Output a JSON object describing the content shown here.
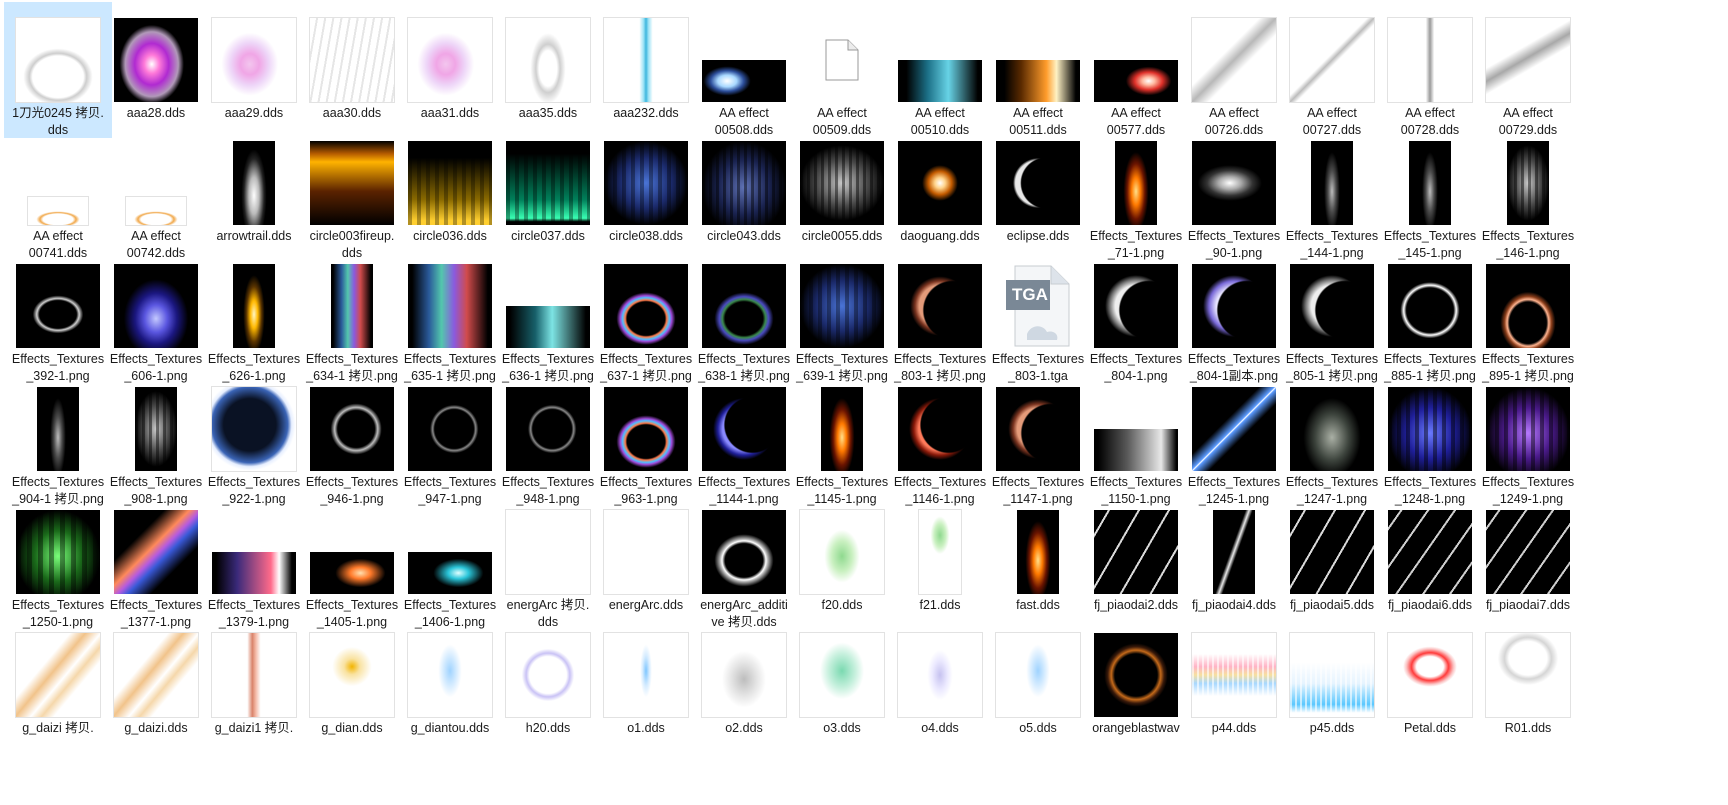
{
  "selected_index": 0,
  "files": [
    {
      "name": "1刀光0245 拷贝.\ndds",
      "style": "arc-white",
      "bg": "#ffffff"
    },
    {
      "name": "aaa28.dds",
      "style": "flame-pink",
      "bg": "#000000"
    },
    {
      "name": "aaa29.dds",
      "style": "flame-pink-soft",
      "bg": "#ffffff"
    },
    {
      "name": "aaa30.dds",
      "style": "rays-grey",
      "bg": "#ffffff"
    },
    {
      "name": "aaa31.dds",
      "style": "flame-pink-soft",
      "bg": "#ffffff"
    },
    {
      "name": "aaa35.dds",
      "style": "arch-grey",
      "bg": "#ffffff"
    },
    {
      "name": "aaa232.dds",
      "style": "spike-blue",
      "bg": "#ffffff"
    },
    {
      "name": "AA    effect\n00508.dds",
      "style": "comet-blue",
      "bg": "#000000",
      "shape": "wide"
    },
    {
      "name": "AA    effect\n00509.dds",
      "style": "doc-icon",
      "bg": "none"
    },
    {
      "name": "AA    effect\n00510.dds",
      "style": "streak-cyan",
      "bg": "#000000",
      "shape": "wide"
    },
    {
      "name": "AA    effect\n00511.dds",
      "style": "streak-orange",
      "bg": "#000000",
      "shape": "wide"
    },
    {
      "name": "AA    effect\n00577.dds",
      "style": "comet-red",
      "bg": "#000000",
      "shape": "wide"
    },
    {
      "name": "AA    effect\n00726.dds",
      "style": "slash-grey",
      "bg": "#ffffff"
    },
    {
      "name": "AA    effect\n00727.dds",
      "style": "slash-thin",
      "bg": "#ffffff"
    },
    {
      "name": "AA    effect\n00728.dds",
      "style": "vline-grey",
      "bg": "#ffffff"
    },
    {
      "name": "AA    effect\n00729.dds",
      "style": "wave-grey",
      "bg": "#ffffff"
    },
    {
      "name": "AA    effect\n00741.dds",
      "style": "swoosh-orange",
      "bg": "#ffffff",
      "shape": "small"
    },
    {
      "name": "AA    effect\n00742.dds",
      "style": "swoosh-orange",
      "bg": "#ffffff",
      "shape": "small"
    },
    {
      "name": "arrowtrail.dds",
      "style": "feather-white",
      "bg": "#000000",
      "shape": "tall"
    },
    {
      "name": "circle003fireup.\ndds",
      "style": "curtain-orange",
      "bg": "#000000"
    },
    {
      "name": "circle036.dds",
      "style": "curtain-gold",
      "bg": "#000000"
    },
    {
      "name": "circle037.dds",
      "style": "curtain-green",
      "bg": "#000000"
    },
    {
      "name": "circle038.dds",
      "style": "curtain-blue",
      "bg": "#000000"
    },
    {
      "name": "circle043.dds",
      "style": "curtain-navy",
      "bg": "#000000"
    },
    {
      "name": "circle0055.dds",
      "style": "curtain-grey",
      "bg": "#000000"
    },
    {
      "name": "daoguang.dds",
      "style": "burst-orange",
      "bg": "#000000"
    },
    {
      "name": "eclipse.dds",
      "style": "crescent-white",
      "bg": "#000000"
    },
    {
      "name": "Effects_Textures\n_71-1.png",
      "style": "flame-orange",
      "bg": "#000000",
      "shape": "tall"
    },
    {
      "name": "Effects_Textures\n_90-1.png",
      "style": "sparks-white",
      "bg": "#000000"
    },
    {
      "name": "Effects_Textures\n_144-1.png",
      "style": "feather-dim",
      "bg": "#000000",
      "shape": "tall"
    },
    {
      "name": "Effects_Textures\n_145-1.png",
      "style": "feather-dim",
      "bg": "#000000",
      "shape": "tall"
    },
    {
      "name": "Effects_Textures\n_146-1.png",
      "style": "curtain-grey",
      "bg": "#000000",
      "shape": "tall"
    },
    {
      "name": "Effects_Textures\n_392-1.png",
      "style": "arc-bottom",
      "bg": "#000000"
    },
    {
      "name": "Effects_Textures\n_606-1.png",
      "style": "flame-blue",
      "bg": "#000000"
    },
    {
      "name": "Effects_Textures\n_626-1.png",
      "style": "flame-gold",
      "bg": "#000000",
      "shape": "tall"
    },
    {
      "name": "Effects_Textures\n_634-1 拷贝.png",
      "style": "curtain-rainbow",
      "bg": "#000000",
      "shape": "tall"
    },
    {
      "name": "Effects_Textures\n_635-1 拷贝.png",
      "style": "curtain-rainbow",
      "bg": "#000000"
    },
    {
      "name": "Effects_Textures\n_636-1 拷贝.png",
      "style": "streak-teal",
      "bg": "#000000",
      "shape": "wide"
    },
    {
      "name": "Effects_Textures\n_637-1 拷贝.png",
      "style": "rings-rainbow",
      "bg": "#000000"
    },
    {
      "name": "Effects_Textures\n_638-1 拷贝.png",
      "style": "rings-dim",
      "bg": "#000000"
    },
    {
      "name": "Effects_Textures\n_639-1 拷贝.png",
      "style": "curtain-blue",
      "bg": "#000000"
    },
    {
      "name": "Effects_Textures\n_803-1 拷贝.png",
      "style": "crescent-copper",
      "bg": "#000000"
    },
    {
      "name": "Effects_Textures\n_803-1.tga",
      "style": "tga-icon",
      "bg": "none",
      "icon_text": "TGA"
    },
    {
      "name": "Effects_Textures\n_804-1.png",
      "style": "crescent-silver",
      "bg": "#000000"
    },
    {
      "name": "Effects_Textures\n_804-1副本.png",
      "style": "crescent-violet",
      "bg": "#000000"
    },
    {
      "name": "Effects_Textures\n_805-1 拷贝.png",
      "style": "crescent-silver",
      "bg": "#000000"
    },
    {
      "name": "Effects_Textures\n_885-1 拷贝.png",
      "style": "ring-white",
      "bg": "#000000"
    },
    {
      "name": "Effects_Textures\n_895-1 拷贝.png",
      "style": "arch-copper",
      "bg": "#000000"
    },
    {
      "name": "Effects_Textures\n_904-1 拷贝.png",
      "style": "feather-dim",
      "bg": "#000000",
      "shape": "tall"
    },
    {
      "name": "Effects_Textures\n_908-1.png",
      "style": "curtain-grey",
      "bg": "#000000",
      "shape": "tall"
    },
    {
      "name": "Effects_Textures\n_922-1.png",
      "style": "orb-blue",
      "bg": "#ffffff"
    },
    {
      "name": "Effects_Textures\n_946-1.png",
      "style": "swirl-grey",
      "bg": "#000000"
    },
    {
      "name": "Effects_Textures\n_947-1.png",
      "style": "swirl-dim",
      "bg": "#000000"
    },
    {
      "name": "Effects_Textures\n_948-1.png",
      "style": "swirl-dim",
      "bg": "#000000"
    },
    {
      "name": "Effects_Textures\n_963-1.png",
      "style": "rings-rainbow",
      "bg": "#000000"
    },
    {
      "name": "Effects_Textures\n_1144-1.png",
      "style": "crescent-blue",
      "bg": "#000000"
    },
    {
      "name": "Effects_Textures\n_1145-1.png",
      "style": "flame-orange",
      "bg": "#000000",
      "shape": "tall"
    },
    {
      "name": "Effects_Textures\n_1146-1.png",
      "style": "crescent-red",
      "bg": "#000000"
    },
    {
      "name": "Effects_Textures\n_1147-1.png",
      "style": "crescent-copper",
      "bg": "#000000"
    },
    {
      "name": "Effects_Textures\n_1150-1.png",
      "style": "comet-white",
      "bg": "#000000",
      "shape": "wide"
    },
    {
      "name": "Effects_Textures\n_1245-1.png",
      "style": "slash-blue",
      "bg": "#000000"
    },
    {
      "name": "Effects_Textures\n_1247-1.png",
      "style": "flame-dim",
      "bg": "#000000"
    },
    {
      "name": "Effects_Textures\n_1248-1.png",
      "style": "curtain-vblue",
      "bg": "#000000"
    },
    {
      "name": "Effects_Textures\n_1249-1.png",
      "style": "curtain-purple",
      "bg": "#000000"
    },
    {
      "name": "Effects_Textures\n_1250-1.png",
      "style": "flame-green",
      "bg": "#000000"
    },
    {
      "name": "Effects_Textures\n_1377-1.png",
      "style": "slash-rainbow",
      "bg": "#000000"
    },
    {
      "name": "Effects_Textures\n_1379-1.png",
      "style": "streak-pink",
      "bg": "#000000",
      "shape": "wide"
    },
    {
      "name": "Effects_Textures\n_1405-1.png",
      "style": "comet-orange",
      "bg": "#000000",
      "shape": "wide"
    },
    {
      "name": "Effects_Textures\n_1406-1.png",
      "style": "comet-cyan",
      "bg": "#000000",
      "shape": "wide"
    },
    {
      "name": "energArc 拷贝.\ndds",
      "style": "blank",
      "bg": "#ffffff"
    },
    {
      "name": "energArc.dds",
      "style": "blank",
      "bg": "#ffffff"
    },
    {
      "name": "energArc_additi\nve 拷贝.dds",
      "style": "arc-glow",
      "bg": "#000000"
    },
    {
      "name": "f20.dds",
      "style": "leaf-green",
      "bg": "#ffffff"
    },
    {
      "name": "f21.dds",
      "style": "leaf-green-small",
      "bg": "#ffffff",
      "shape": "tall"
    },
    {
      "name": "fast.dds",
      "style": "flame-orange",
      "bg": "#000000",
      "shape": "tall"
    },
    {
      "name": "fj_piaodai2.dds",
      "style": "strokes-white",
      "bg": "#000000"
    },
    {
      "name": "fj_piaodai4.dds",
      "style": "stroke-single",
      "bg": "#000000",
      "shape": "tall"
    },
    {
      "name": "fj_piaodai5.dds",
      "style": "strokes-white",
      "bg": "#000000"
    },
    {
      "name": "fj_piaodai6.dds",
      "style": "strokes-diag",
      "bg": "#000000"
    },
    {
      "name": "fj_piaodai7.dds",
      "style": "strokes-diag",
      "bg": "#000000"
    },
    {
      "name": "g_daizi 拷贝.",
      "style": "ribbon-gold",
      "bg": "#ffffff",
      "cut": true
    },
    {
      "name": "g_daizi.dds",
      "style": "ribbon-gold",
      "bg": "#ffffff",
      "cut": true
    },
    {
      "name": "g_daizi1 拷贝.",
      "style": "ribbon-red",
      "bg": "#ffffff",
      "cut": true
    },
    {
      "name": "g_dian.dds",
      "style": "spark-gold",
      "bg": "#ffffff",
      "cut": true
    },
    {
      "name": "g_diantou.dds",
      "style": "drop-blue",
      "bg": "#ffffff",
      "cut": true
    },
    {
      "name": "h20.dds",
      "style": "ring-lavender",
      "bg": "#ffffff",
      "cut": true
    },
    {
      "name": "o1.dds",
      "style": "drop-blue-thin",
      "bg": "#ffffff",
      "cut": true
    },
    {
      "name": "o2.dds",
      "style": "mist-grey",
      "bg": "#ffffff",
      "cut": true
    },
    {
      "name": "o3.dds",
      "style": "leaf-mint",
      "bg": "#ffffff",
      "cut": true
    },
    {
      "name": "o4.dds",
      "style": "mist-lavender",
      "bg": "#ffffff",
      "cut": true
    },
    {
      "name": "o5.dds",
      "style": "drop-blue",
      "bg": "#ffffff",
      "cut": true
    },
    {
      "name": "orangeblastwav",
      "style": "ring-orange",
      "bg": "#000000",
      "cut": true
    },
    {
      "name": "p44.dds",
      "style": "bars-rainbow",
      "bg": "#ffffff",
      "cut": true
    },
    {
      "name": "p45.dds",
      "style": "bars-cyan",
      "bg": "#ffffff",
      "cut": true
    },
    {
      "name": "Petal.dds",
      "style": "petal-red",
      "bg": "#ffffff",
      "cut": true
    },
    {
      "name": "R01.dds",
      "style": "arc-grey-soft",
      "bg": "#ffffff",
      "cut": true
    }
  ]
}
